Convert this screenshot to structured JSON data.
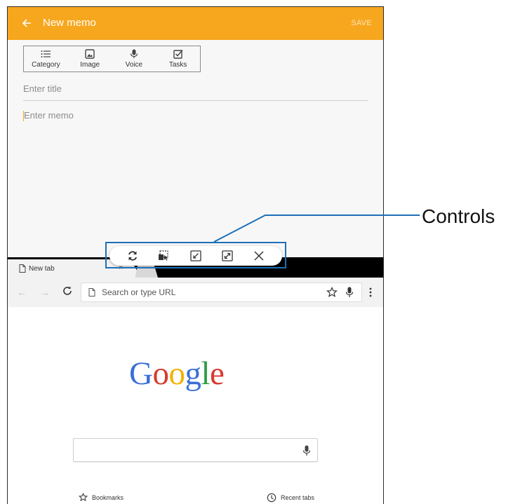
{
  "colors": {
    "memo_header": "#f7a71e",
    "callout_blue": "#1d6fb8",
    "google_blue": "#3b6fd8",
    "google_red": "#d63b2f",
    "google_yellow": "#f2b300",
    "google_green": "#2f9e44"
  },
  "memo": {
    "title": "New memo",
    "save_label": "SAVE",
    "back_icon": "arrow-left-icon",
    "toolbar": [
      {
        "label": "Category",
        "icon": "list-icon"
      },
      {
        "label": "Image",
        "icon": "image-icon"
      },
      {
        "label": "Voice",
        "icon": "microphone-icon"
      },
      {
        "label": "Tasks",
        "icon": "checkbox-icon"
      }
    ],
    "title_placeholder": "Enter title",
    "memo_placeholder": "Enter memo"
  },
  "browser": {
    "tab_title": "New tab",
    "tab_close": "×",
    "nav_back": "←",
    "nav_forward": "→",
    "url_placeholder": "Search or type URL",
    "logo": [
      "G",
      "o",
      "o",
      "g",
      "l",
      "e"
    ],
    "bookmarks_label": "Bookmarks",
    "recent_tabs_label": "Recent tabs"
  },
  "controls": {
    "icons": [
      "swap-windows-icon",
      "drag-drop-icon",
      "minimize-icon",
      "maximize-icon",
      "close-icon"
    ]
  },
  "callout": {
    "label": "Controls"
  }
}
